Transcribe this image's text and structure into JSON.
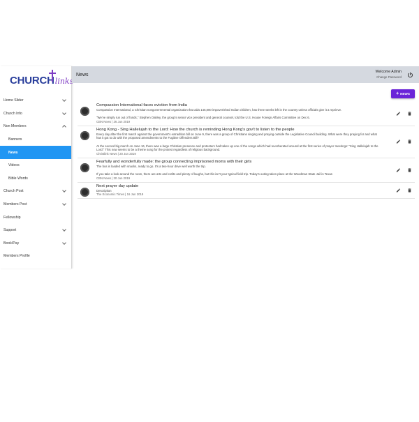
{
  "logo": {
    "word": "CHURCH",
    "script": "links"
  },
  "sidebar": {
    "items": [
      {
        "label": "Home Slider",
        "chevron": "down"
      },
      {
        "label": "Church Info",
        "chevron": "down"
      },
      {
        "label": "Non Members",
        "chevron": "up"
      },
      {
        "label": "Banners",
        "sub": true
      },
      {
        "label": "News",
        "sub": true,
        "active": true
      },
      {
        "label": "Videos",
        "sub": true
      },
      {
        "label": "Bible Words",
        "sub": true
      },
      {
        "label": "Church Post",
        "chevron": "down"
      },
      {
        "label": "Members Post",
        "chevron": "down"
      },
      {
        "label": "Fellowship"
      },
      {
        "label": "Support",
        "chevron": "down"
      },
      {
        "label": "Book/Pay",
        "chevron": "down"
      },
      {
        "label": "Members Profile"
      }
    ]
  },
  "header": {
    "title": "News",
    "welcome": "Welcome Admin",
    "change_password": "Change Password"
  },
  "toolbar": {
    "add_news_label": "NEWS"
  },
  "news": [
    {
      "title": "Compassion International faces eviction from India",
      "description": "Compassion International, a Christian nongovernmental organization that aids 145,000 impoverished Indian children, has three weeks left in the country unless officials give it a reprieve.\n\n\"We've simply run out of funds,\" Stephen Oakley, the group's senior vice president and general counsel, told the U.S. House Foreign Affairs Committee on Dec 6.",
      "meta": "CBN News | 26 Jun 2019"
    },
    {
      "title": "Hong Kong - Sing Hallelujah to the Lord: How the church is reminding Hong Kong's gov't to listen to the people",
      "description": "Every day after the first march against the government's extradition bill on June 9, there was a group of Christians singing and praying outside the Legislative Council building. What were they praying for and what has it got to do with the proposed amendments to the Fugitive Offenders Bill?\n\nAt the second big march on June 16, there was a large Christian presence and protesters had taken up one of the songs which had reverberated around at the first series of prayer meetings: \"Sing Hallelujah to the Lord.\" This now seems to be a theme song for the protest regardless of religious background.",
      "meta": "Christlink News | 20 Jun 2019"
    },
    {
      "title": "Fearfully and wonderfully made: the group connecting imprisoned moms with their girls",
      "description": "The bus is loaded with snacks, ready to go. It's a two-hour drive well worth the trip.\n\nIf you take a look around the room, there are arts and crafts and plenty of laughs, but this isn't your typical field trip. Today's outing takes place at the Woodman State Jail in Texas",
      "meta": "CBN News | 30 Jun 2019"
    },
    {
      "title": "Next prayer day update",
      "description": "Descripiton",
      "meta": "The Economic Times | 16 Jun 2019"
    }
  ],
  "colors": {
    "accent": "#2196f3",
    "add_button": "#6a24d8",
    "header_bg": "#d5d9e0",
    "logo_blue": "#2a3f9c",
    "logo_purple": "#7e3cc4"
  },
  "icons": [
    "power-icon",
    "plus-icon",
    "edit-icon",
    "delete-icon",
    "chevron-down-icon",
    "chevron-up-icon"
  ]
}
